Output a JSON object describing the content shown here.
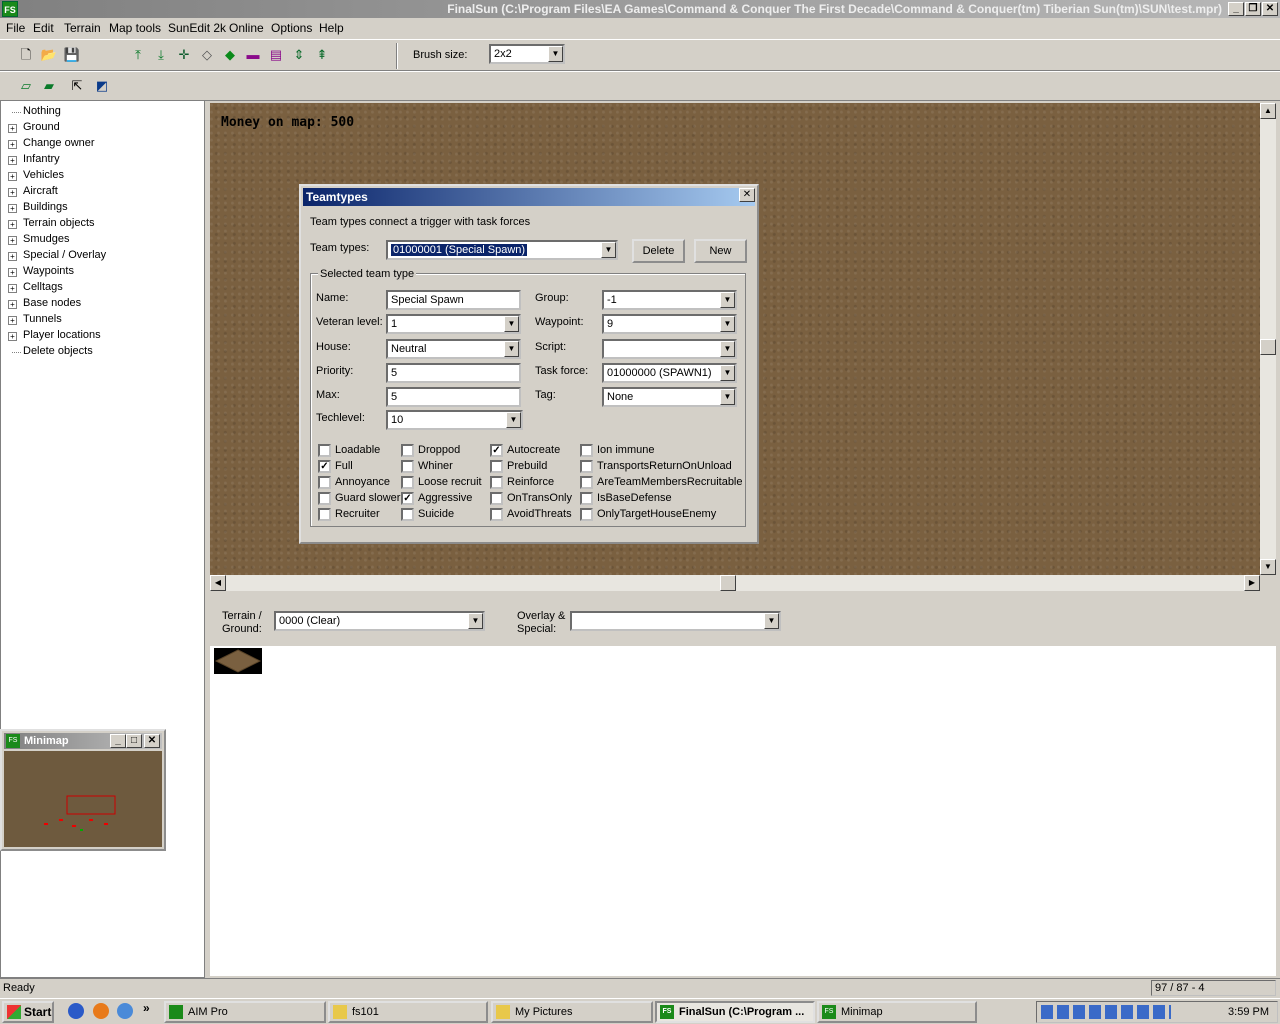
{
  "window": {
    "title": "FinalSun (C:\\Program Files\\EA Games\\Command & Conquer The First Decade\\Command & Conquer(tm) Tiberian Sun(tm)\\SUN\\test.mpr)",
    "app_icon": "FS"
  },
  "menu": [
    "File",
    "Edit",
    "Terrain",
    "Map tools",
    "SunEdit 2k",
    "Online",
    "Options",
    "Help"
  ],
  "toolbar": {
    "brush_label": "Brush size:",
    "brush_value": "2x2"
  },
  "tree": {
    "items": [
      {
        "label": "Nothing",
        "expandable": false
      },
      {
        "label": "Ground",
        "expandable": true
      },
      {
        "label": "Change owner",
        "expandable": true
      },
      {
        "label": "Infantry",
        "expandable": true
      },
      {
        "label": "Vehicles",
        "expandable": true
      },
      {
        "label": "Aircraft",
        "expandable": true
      },
      {
        "label": "Buildings",
        "expandable": true
      },
      {
        "label": "Terrain objects",
        "expandable": true
      },
      {
        "label": "Smudges",
        "expandable": true
      },
      {
        "label": "Special / Overlay",
        "expandable": true
      },
      {
        "label": "Waypoints",
        "expandable": true
      },
      {
        "label": "Celltags",
        "expandable": true
      },
      {
        "label": "Base nodes",
        "expandable": true
      },
      {
        "label": "Tunnels",
        "expandable": true
      },
      {
        "label": "Player locations",
        "expandable": true
      },
      {
        "label": "Delete objects",
        "expandable": false
      }
    ]
  },
  "map": {
    "money_text": "Money on map: 500"
  },
  "dialog": {
    "title": "Teamtypes",
    "description": "Team types connect a trigger with task forces",
    "teamtypes_label": "Team types:",
    "teamtypes_value": "01000001 (Special Spawn)",
    "delete_label": "Delete",
    "new_label": "New",
    "group_label": "Selected team type",
    "fields": {
      "name_label": "Name:",
      "name_value": "Special Spawn",
      "veteran_label": "Veteran level:",
      "veteran_value": "1",
      "house_label": "House:",
      "house_value": "Neutral",
      "priority_label": "Priority:",
      "priority_value": "5",
      "max_label": "Max:",
      "max_value": "5",
      "techlevel_label": "Techlevel:",
      "techlevel_value": "10",
      "groupnum_label": "Group:",
      "groupnum_value": "-1",
      "waypoint_label": "Waypoint:",
      "waypoint_value": "9",
      "script_label": "Script:",
      "script_value": "",
      "taskforce_label": "Task force:",
      "taskforce_value": "01000000 (SPAWN1)",
      "tag_label": "Tag:",
      "tag_value": "None"
    },
    "checkboxes": [
      [
        {
          "label": "Loadable",
          "checked": false
        },
        {
          "label": "Full",
          "checked": true
        },
        {
          "label": "Annoyance",
          "checked": false
        },
        {
          "label": "Guard slower",
          "checked": false
        },
        {
          "label": "Recruiter",
          "checked": false
        }
      ],
      [
        {
          "label": "Droppod",
          "checked": false
        },
        {
          "label": "Whiner",
          "checked": false
        },
        {
          "label": "Loose recruit",
          "checked": false
        },
        {
          "label": "Aggressive",
          "checked": true
        },
        {
          "label": "Suicide",
          "checked": false
        }
      ],
      [
        {
          "label": "Autocreate",
          "checked": true
        },
        {
          "label": "Prebuild",
          "checked": false
        },
        {
          "label": "Reinforce",
          "checked": false
        },
        {
          "label": "OnTransOnly",
          "checked": false
        },
        {
          "label": "AvoidThreats",
          "checked": false
        }
      ],
      [
        {
          "label": "Ion immune",
          "checked": false
        },
        {
          "label": "TransportsReturnOnUnload",
          "checked": false
        },
        {
          "label": "AreTeamMembersRecruitable",
          "checked": false
        },
        {
          "label": "IsBaseDefense",
          "checked": false
        },
        {
          "label": "OnlyTargetHouseEnemy",
          "checked": false
        }
      ]
    ]
  },
  "bottom": {
    "terrain_label_1": "Terrain /",
    "terrain_label_2": "Ground:",
    "terrain_value": "0000 (Clear)",
    "overlay_label_1": "Overlay &",
    "overlay_label_2": "Special:",
    "overlay_value": ""
  },
  "minimap": {
    "title": "Minimap"
  },
  "status": {
    "text": "Ready",
    "coords": "97 / 87 - 4"
  },
  "taskbar": {
    "start": "Start",
    "tasks": [
      {
        "label": "AIM Pro",
        "active": false
      },
      {
        "label": "fs101",
        "active": false
      },
      {
        "label": "My Pictures",
        "active": false
      },
      {
        "label": "FinalSun (C:\\Program ...",
        "active": true
      },
      {
        "label": "Minimap",
        "active": false
      }
    ],
    "clock": "3:59 PM"
  },
  "colors": {
    "accent": "#0a246a",
    "map_ground": "#7a6040"
  }
}
